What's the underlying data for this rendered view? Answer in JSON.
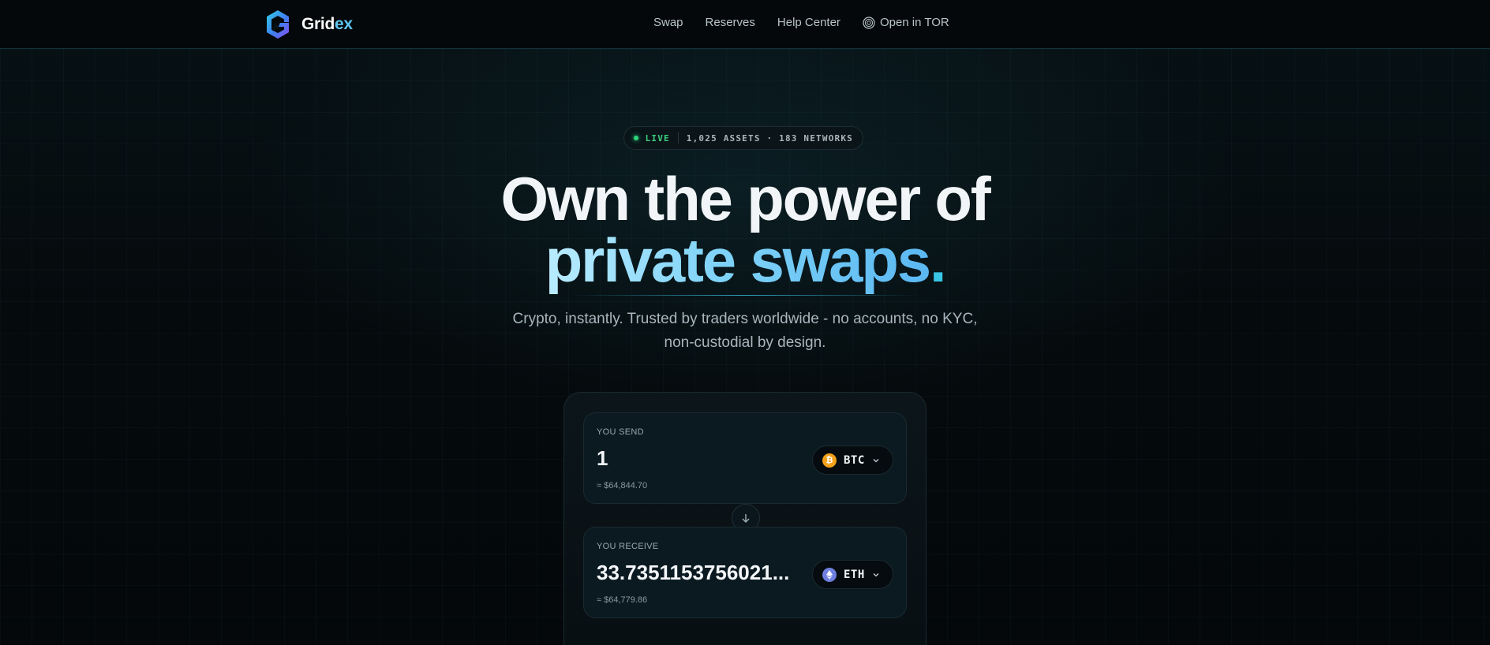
{
  "nav": {
    "brand_part1": "Grid",
    "brand_part2": "ex",
    "links": {
      "swap": "Swap",
      "reserves": "Reserves",
      "help_center": "Help Center",
      "open_tor": "Open in TOR"
    }
  },
  "badge": {
    "live": "LIVE",
    "stats": "1,025 ASSETS · 183 NETWORKS"
  },
  "hero": {
    "line1": "Own the power of",
    "line2": "private swaps",
    "line2_dot": ".",
    "subtitle_line1": "Crypto, instantly. Trusted by traders worldwide - no accounts, no KYC,",
    "subtitle_line2": "non-custodial by design."
  },
  "swap": {
    "send": {
      "label": "YOU SEND",
      "amount": "1",
      "usd": "≈ $64,844.70",
      "token": "BTC",
      "token_icon": "bitcoin-icon"
    },
    "receive": {
      "label": "YOU RECEIVE",
      "amount": "33.7351153756021...",
      "usd": "≈ $64,779.86",
      "token": "ETH",
      "token_icon": "ethereum-icon"
    },
    "flip_icon": "arrow-down-icon"
  },
  "colors": {
    "accent": "#39c6e6",
    "brand_secondary": "#5ec4f0",
    "live": "#2ed47a",
    "btc": "#f4a11a",
    "eth": "#6e7fe0",
    "background": "#05090b"
  }
}
